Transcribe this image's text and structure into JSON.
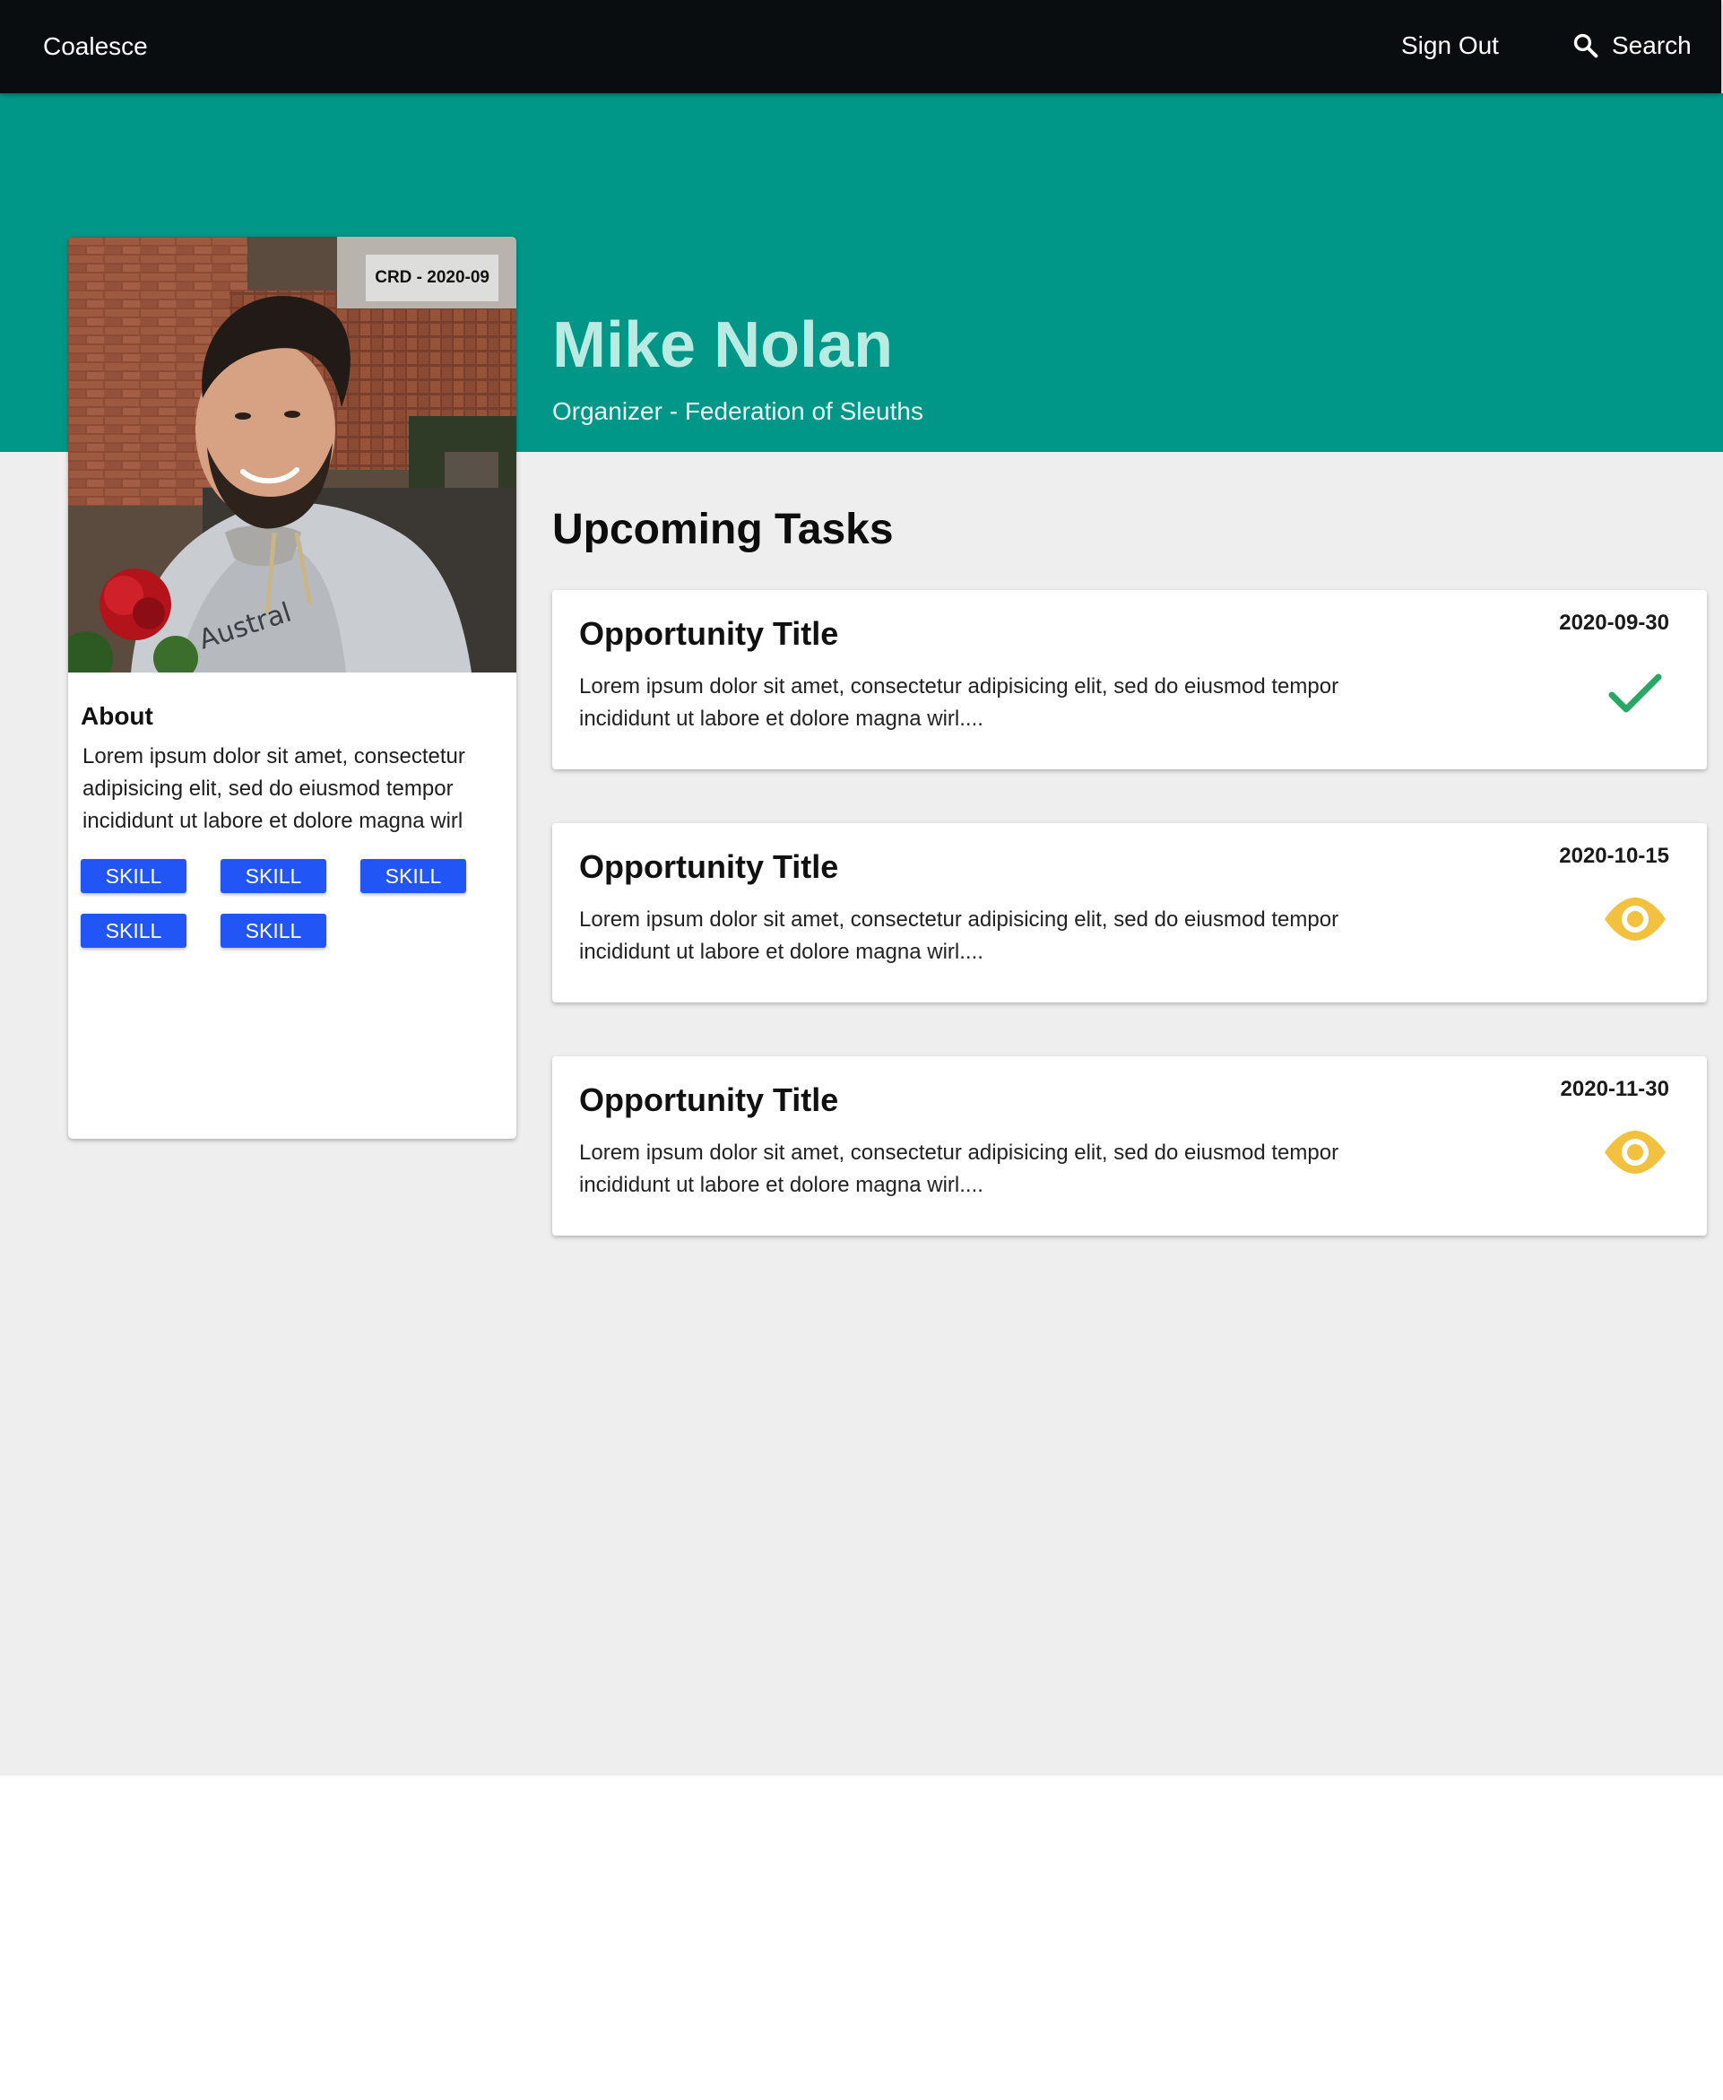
{
  "nav": {
    "brand": "Coalesce",
    "sign_out": "Sign Out",
    "search_label": "Search",
    "search_icon": "magnifier-icon"
  },
  "profile": {
    "name": "Mike Nolan",
    "role": "Organizer - Federation of Sleuths",
    "badge": "CRD - 2020-09",
    "about_title": "About",
    "about_text": "Lorem ipsum dolor sit amet, consectetur adipisicing elit, sed do eiusmod tempor incididunt ut labore et dolore magna wirl",
    "skills": [
      "SKILL",
      "SKILL",
      "SKILL",
      "SKILL",
      "SKILL"
    ]
  },
  "tasks": {
    "heading": "Upcoming Tasks",
    "items": [
      {
        "title": "Opportunity Title",
        "description": "Lorem ipsum dolor sit amet, consectetur adipisicing elit, sed do eiusmod tempor incididunt ut labore et dolore magna wirl....",
        "date": "2020-09-30",
        "status_icon": "checkmark-icon"
      },
      {
        "title": "Opportunity Title",
        "description": "Lorem ipsum dolor sit amet, consectetur adipisicing elit, sed do eiusmod tempor incididunt ut labore et dolore magna wirl....",
        "date": "2020-10-15",
        "status_icon": "eye-icon"
      },
      {
        "title": "Opportunity Title",
        "description": "Lorem ipsum dolor sit amet, consectetur adipisicing elit, sed do eiusmod tempor incididunt ut labore et dolore magna wirl....",
        "date": "2020-11-30",
        "status_icon": "eye-icon"
      }
    ]
  },
  "colors": {
    "topbar": "#0a0d0f",
    "hero": "#009688",
    "name": "#b8ebe2",
    "skill": "#2155f5",
    "check": "#27a866",
    "eye": "#f2c140",
    "background": "#eeeeee"
  }
}
